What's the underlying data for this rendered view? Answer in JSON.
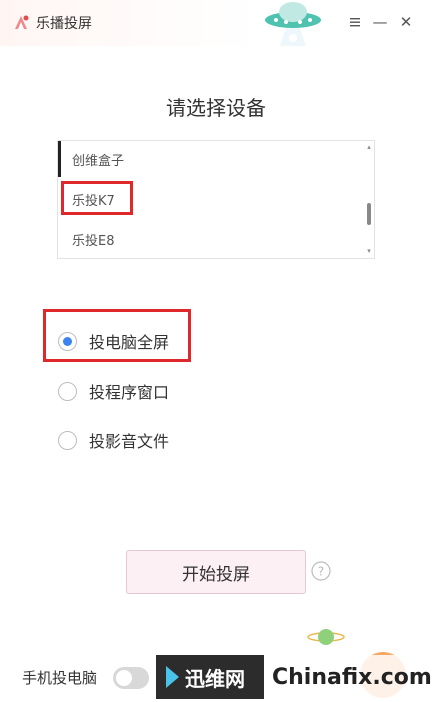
{
  "app": {
    "title": "乐播投屏"
  },
  "window_controls": {
    "menu_icon": "menu-icon",
    "minimize_icon": "minimize-icon",
    "close_icon": "close-icon",
    "minimize_glyph": "—",
    "close_glyph": "✕"
  },
  "main": {
    "heading": "请选择设备"
  },
  "devices": {
    "items": [
      "创维盒子",
      "乐投K7",
      "乐投E8"
    ],
    "selected_index": 0,
    "highlighted_index": 1
  },
  "modes": {
    "items": [
      "投电脑全屏",
      "投程序窗口",
      "投影音文件"
    ],
    "selected_index": 0
  },
  "actions": {
    "start_label": "开始投屏"
  },
  "footer": {
    "phone_to_pc_label": "手机投电脑",
    "toggle_on": false
  },
  "watermark": {
    "brand_cn": "迅维网",
    "brand_en": "Chinafix.com"
  },
  "colors": {
    "highlight_box": "#e0282c",
    "radio_selected": "#3c82f0",
    "start_button_bg": "#fdf0f4"
  }
}
